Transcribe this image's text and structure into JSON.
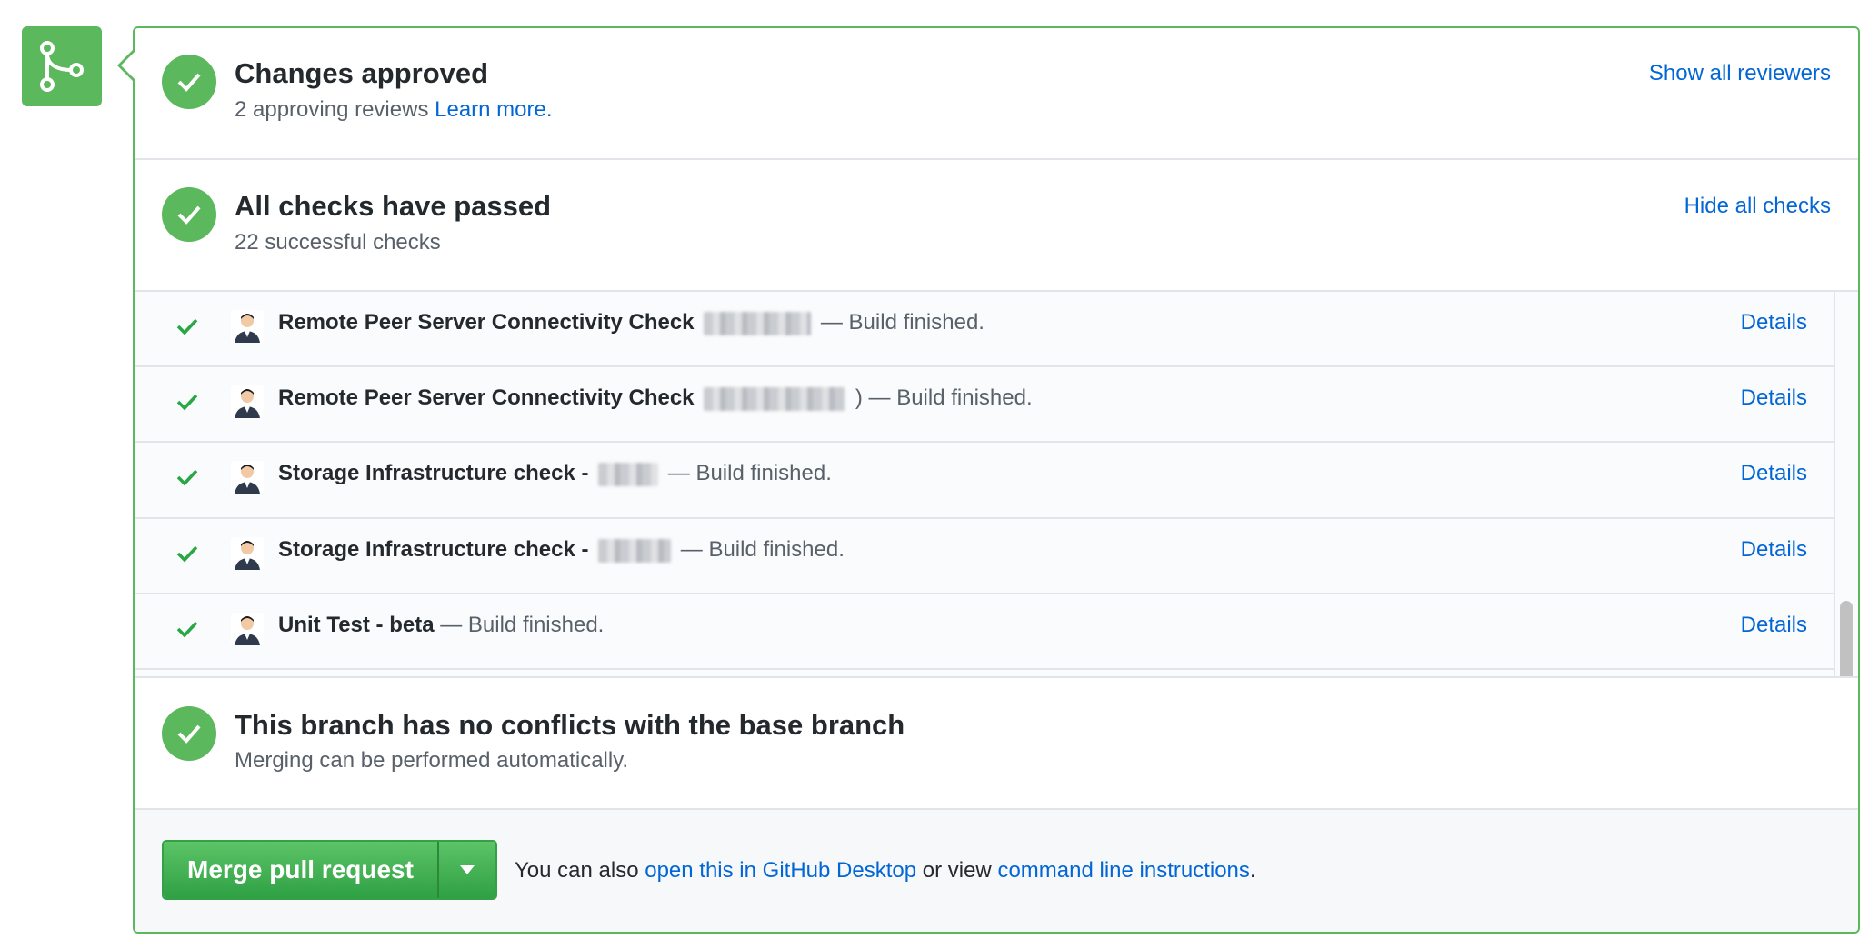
{
  "approved": {
    "title": "Changes approved",
    "subtitle": "2 approving reviews",
    "learn_more": "Learn more.",
    "action": "Show all reviewers"
  },
  "checks": {
    "title": "All checks have passed",
    "subtitle": "22 successful checks",
    "action": "Hide all checks",
    "rows": [
      {
        "name": "Remote Peer Server Connectivity Check",
        "after": "— Build finished.",
        "details": "Details"
      },
      {
        "name": "Remote Peer Server Connectivity Check",
        "after": ") — Build finished.",
        "details": "Details"
      },
      {
        "name": "Storage Infrastructure check -",
        "after": "— Build finished.",
        "details": "Details"
      },
      {
        "name": "Storage Infrastructure check -",
        "after": "— Build finished.",
        "details": "Details"
      },
      {
        "name": "Unit Test - beta",
        "after": "— Build finished.",
        "details": "Details"
      }
    ]
  },
  "conflicts": {
    "title": "This branch has no conflicts with the base branch",
    "subtitle": "Merging can be performed automatically."
  },
  "merge": {
    "button_label": "Merge pull request",
    "alt_prefix": "You can also",
    "desktop_link": "open this in GitHub Desktop",
    "alt_middle": "or view",
    "cli_link": "command line instructions",
    "alt_suffix": "."
  },
  "colors": {
    "success_green": "#5cb85c",
    "link_blue": "#0366d6"
  },
  "icons": {
    "merge_badge": "git-merge-icon",
    "status": "check-circle-icon",
    "row_status": "check-icon",
    "dropdown": "triangle-down-icon"
  }
}
